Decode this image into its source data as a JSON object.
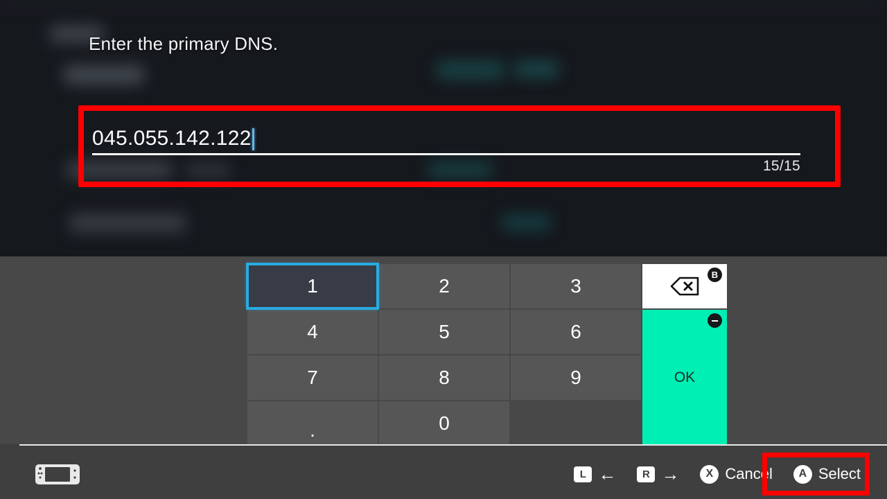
{
  "dialog": {
    "prompt": "Enter the primary DNS.",
    "input": {
      "value": "045.055.142.122",
      "char_count": "15/15",
      "caret_visible": true
    }
  },
  "keypad": {
    "keys": [
      {
        "label": "1",
        "name": "key-1",
        "selected": true
      },
      {
        "label": "2",
        "name": "key-2",
        "selected": false
      },
      {
        "label": "3",
        "name": "key-3",
        "selected": false
      },
      {
        "label": "4",
        "name": "key-4",
        "selected": false
      },
      {
        "label": "5",
        "name": "key-5",
        "selected": false
      },
      {
        "label": "6",
        "name": "key-6",
        "selected": false
      },
      {
        "label": "7",
        "name": "key-7",
        "selected": false
      },
      {
        "label": "8",
        "name": "key-8",
        "selected": false
      },
      {
        "label": "9",
        "name": "key-9",
        "selected": false
      },
      {
        "label": ".",
        "name": "key-period",
        "selected": false
      },
      {
        "label": "0",
        "name": "key-0",
        "selected": false
      },
      {
        "label": "",
        "name": "key-blank",
        "selected": false
      }
    ],
    "backspace": {
      "icon": "backspace-icon",
      "badge": "B"
    },
    "ok": {
      "label": "OK",
      "badge": "−"
    }
  },
  "bottom_bar": {
    "console_icon": "nintendo-switch-console-icon",
    "hints": [
      {
        "button": "L",
        "label": "←",
        "name": "hint-prev"
      },
      {
        "button": "R",
        "label": "→",
        "name": "hint-next"
      },
      {
        "button": "X",
        "label": "Cancel",
        "name": "hint-cancel"
      },
      {
        "button": "A",
        "label": "Select",
        "name": "hint-select"
      }
    ]
  },
  "colors": {
    "annotation": "#fe0000",
    "selection": "#29abe2",
    "ok_key": "#00efb4",
    "caret": "#64b5e8",
    "keypad_bg": "#484848",
    "key_face": "#565657"
  }
}
